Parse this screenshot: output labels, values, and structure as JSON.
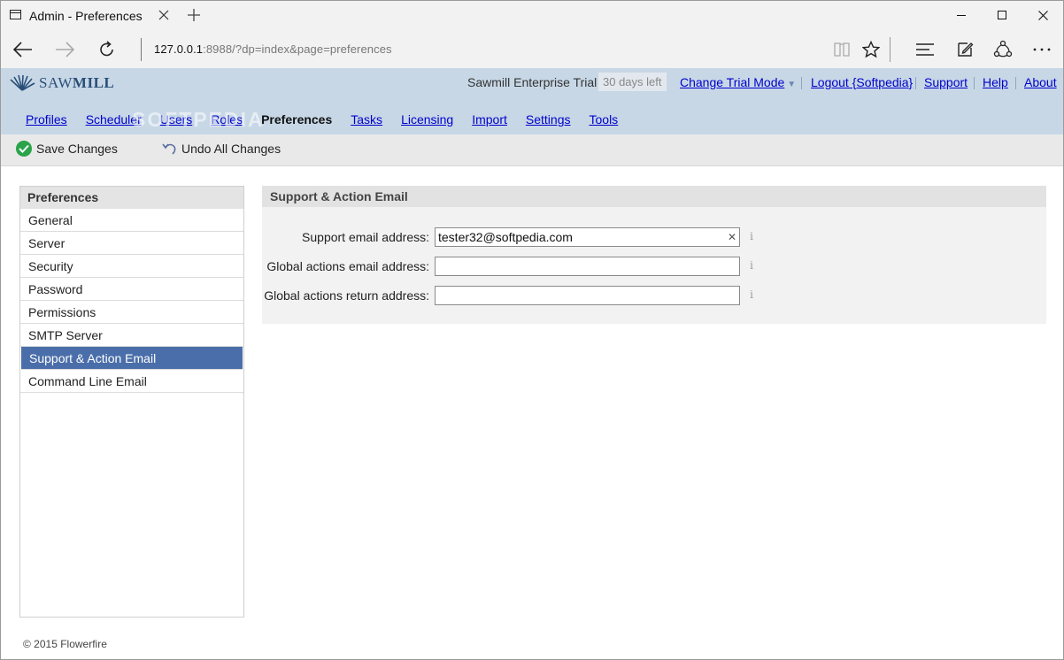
{
  "browser": {
    "tab_title": "Admin - Preferences",
    "url_host": "127.0.0.1",
    "url_rest": ":8988/?dp=index&page=preferences"
  },
  "header": {
    "logo_text_light": "SAW",
    "logo_text_bold": "MILL",
    "trial_label": "Sawmill Enterprise Trial",
    "days_left": "30 days left",
    "change_trial_mode": "Change Trial Mode",
    "logout": "Logout {Softpedia}",
    "support": "Support",
    "help": "Help",
    "about": "About",
    "watermark": "SOFTPEDIA"
  },
  "menu": {
    "items": [
      {
        "label": "Profiles",
        "active": false
      },
      {
        "label": "Scheduler",
        "active": false
      },
      {
        "label": "Users",
        "active": false
      },
      {
        "label": "Roles",
        "active": false
      },
      {
        "label": "Preferences",
        "active": true
      },
      {
        "label": "Tasks",
        "active": false
      },
      {
        "label": "Licensing",
        "active": false
      },
      {
        "label": "Import",
        "active": false
      },
      {
        "label": "Settings",
        "active": false
      },
      {
        "label": "Tools",
        "active": false
      }
    ]
  },
  "toolbar": {
    "save_label": "Save Changes",
    "undo_label": "Undo All Changes"
  },
  "sidebar": {
    "title": "Preferences",
    "items": [
      {
        "label": "General"
      },
      {
        "label": "Server"
      },
      {
        "label": "Security"
      },
      {
        "label": "Password"
      },
      {
        "label": "Permissions"
      },
      {
        "label": "SMTP Server"
      },
      {
        "label": "Support & Action Email",
        "selected": true
      },
      {
        "label": "Command Line Email"
      }
    ]
  },
  "panel": {
    "title": "Support & Action Email",
    "fields": [
      {
        "label": "Support email address:",
        "value": "tester32@softpedia.com",
        "info": "i"
      },
      {
        "label": "Global actions email address:",
        "value": "",
        "info": "i"
      },
      {
        "label": "Global actions return address:",
        "value": "",
        "info": "i"
      }
    ]
  },
  "footer": {
    "copyright": "© 2015 Flowerfire"
  },
  "colors": {
    "header_bg": "#c7d7e6",
    "selected_bg": "#4a6ea9",
    "link": "#0000cc",
    "save_icon": "#2aa44a"
  },
  "icons": [
    "tab-page-icon",
    "close-icon",
    "plus-icon",
    "back-arrow-icon",
    "forward-arrow-icon",
    "refresh-icon",
    "reading-view-icon",
    "star-icon",
    "hub-icon",
    "web-note-icon",
    "share-icon",
    "more-icon",
    "sawmill-logo-icon",
    "check-icon",
    "undo-icon",
    "info-icon"
  ]
}
